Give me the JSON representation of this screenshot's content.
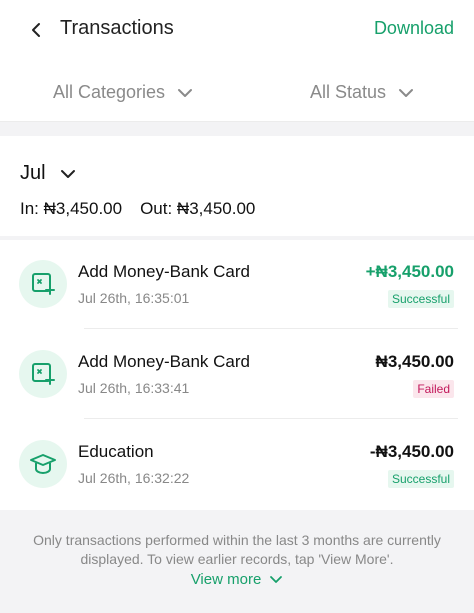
{
  "header": {
    "title": "Transactions",
    "download_label": "Download"
  },
  "filters": {
    "category": "All Categories",
    "status": "All Status"
  },
  "summary": {
    "month": "Jul",
    "in_text": "In: ₦3,450.00",
    "out_text": "Out: ₦3,450.00"
  },
  "transactions": [
    {
      "name": "Add Money-Bank Card",
      "time": "Jul 26th, 16:35:01",
      "amount": "+₦3,450.00",
      "status": "Successful"
    },
    {
      "name": "Add Money-Bank Card",
      "time": "Jul 26th, 16:33:41",
      "amount": "₦3,450.00",
      "status": "Failed"
    },
    {
      "name": "Education",
      "time": "Jul 26th, 16:32:22",
      "amount": "-₦3,450.00",
      "status": "Successful"
    }
  ],
  "footer": {
    "note": "Only transactions performed within the last 3 months are currently displayed. To view earlier records, tap 'View More'.",
    "view_more_label": "View more"
  },
  "colors": {
    "accent": "#17a06b",
    "failed": "#c2185b"
  },
  "icons": {
    "back": "chevron-left-icon",
    "dropdown": "chevron-down-icon",
    "bank_card": "bank-card-add-icon",
    "education": "graduation-cap-icon"
  }
}
